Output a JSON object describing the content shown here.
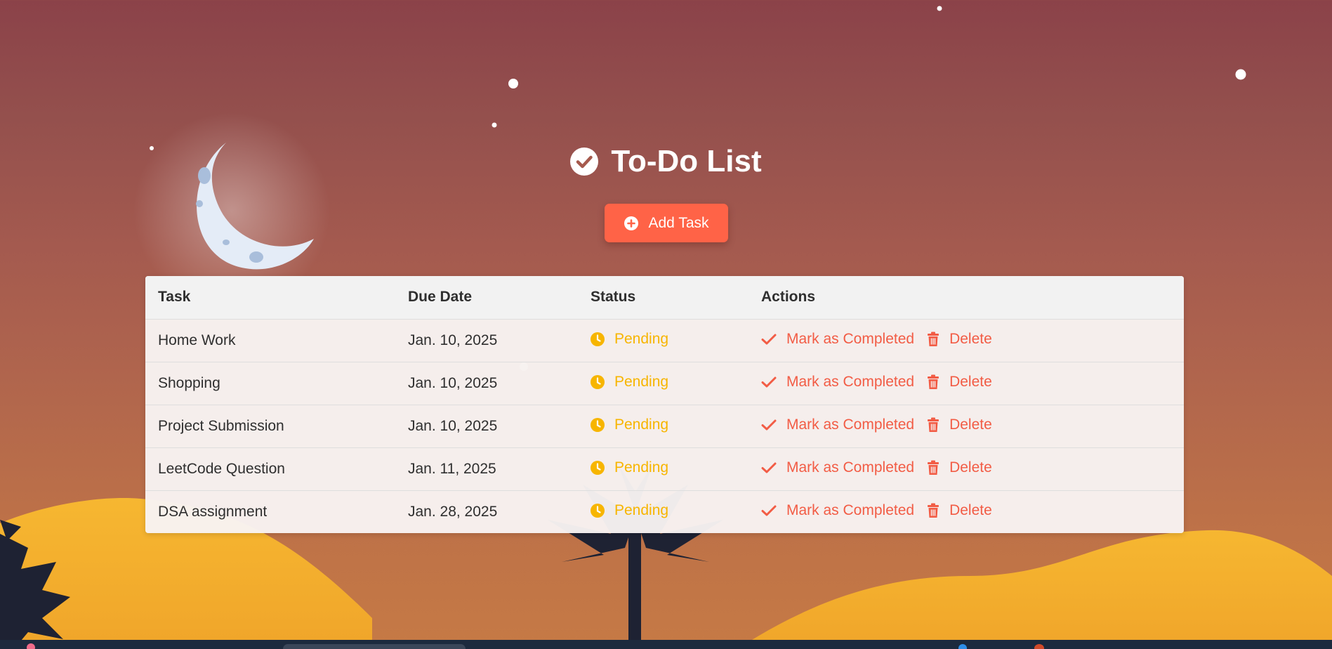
{
  "colors": {
    "accent": "#ff6347",
    "pending": "#f7b500",
    "action": "#f25c45",
    "header_bg": "#f2f2f2"
  },
  "header": {
    "title": "To-Do List",
    "title_icon": "check-circle-icon"
  },
  "add_button": {
    "label": "Add Task",
    "icon": "plus-circle-icon"
  },
  "table": {
    "columns": [
      "Task",
      "Due Date",
      "Status",
      "Actions"
    ],
    "rows": [
      {
        "task": "Home Work",
        "due": "Jan. 10, 2025",
        "status": "Pending",
        "complete_label": "Mark as Completed",
        "delete_label": "Delete"
      },
      {
        "task": "Shopping",
        "due": "Jan. 10, 2025",
        "status": "Pending",
        "complete_label": "Mark as Completed",
        "delete_label": "Delete"
      },
      {
        "task": "Project Submission",
        "due": "Jan. 10, 2025",
        "status": "Pending",
        "complete_label": "Mark as Completed",
        "delete_label": "Delete"
      },
      {
        "task": "LeetCode Question",
        "due": "Jan. 11, 2025",
        "status": "Pending",
        "complete_label": "Mark as Completed",
        "delete_label": "Delete"
      },
      {
        "task": "DSA assignment",
        "due": "Jan. 28, 2025",
        "status": "Pending",
        "complete_label": "Mark as Completed",
        "delete_label": "Delete"
      }
    ],
    "status_icon": "clock-icon",
    "complete_icon": "check-icon",
    "delete_icon": "trash-icon"
  }
}
